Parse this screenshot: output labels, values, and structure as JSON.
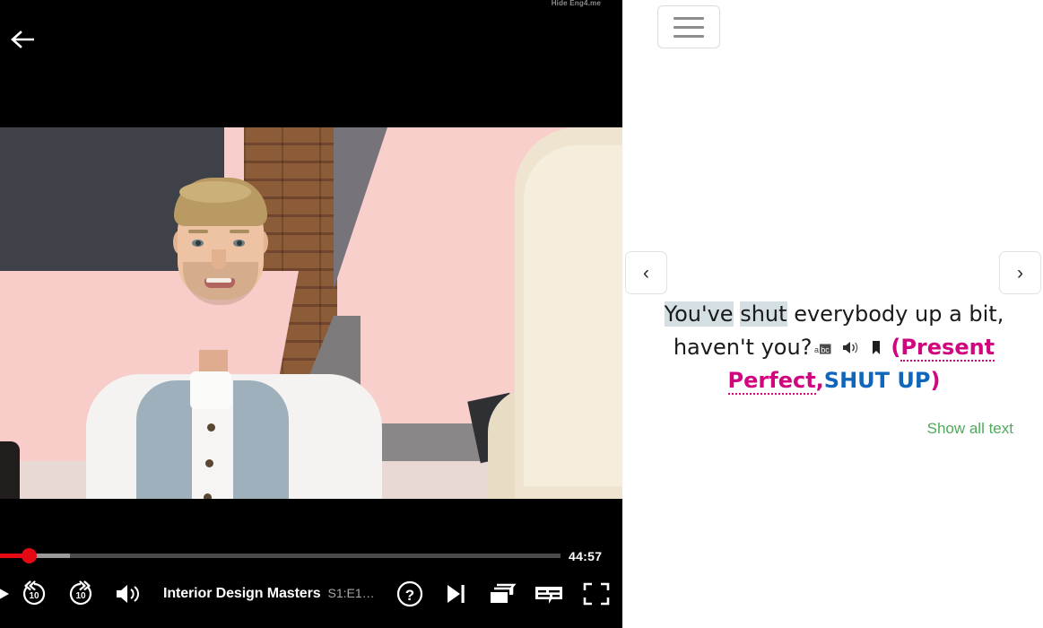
{
  "player": {
    "hide_label": "Hide Eng4.me",
    "back_icon": "back-arrow-icon",
    "time_remaining": "44:57",
    "title": "Interior Design Masters",
    "episode": "S1:E1…",
    "controls": {
      "play": "Play",
      "rewind": "Back 10 seconds",
      "forward": "Forward 10 seconds",
      "volume": "Volume",
      "help": "Help",
      "next_episode": "Next episode",
      "episodes": "Episodes",
      "subtitles": "Subtitles and audio",
      "fullscreen": "Full screen"
    },
    "progress": {
      "played_percent": 5,
      "buffered_percent": 12
    }
  },
  "panel": {
    "menu_label": "Menu",
    "prev_label": "‹",
    "next_label": "›",
    "subtitle": {
      "highlight_1": "You've",
      "highlight_2": "shut",
      "rest_line1": "everybody up a bit, haven't",
      "rest_line2": "you?",
      "icons": [
        "abc-icon",
        "speaker-icon",
        "bookmark-icon"
      ],
      "paren_open": "(",
      "grammar_tag": "Present Perfect",
      "comma": ",",
      "phrase_tag": "SHUT UP",
      "paren_close": ")"
    },
    "show_all_text": "Show all text"
  },
  "colors": {
    "netflix_red": "#e50914",
    "highlight": "#d3dfe3",
    "grammar_pink": "#d1057e",
    "phrase_blue": "#1166bb",
    "link_green": "#4faa5c"
  }
}
